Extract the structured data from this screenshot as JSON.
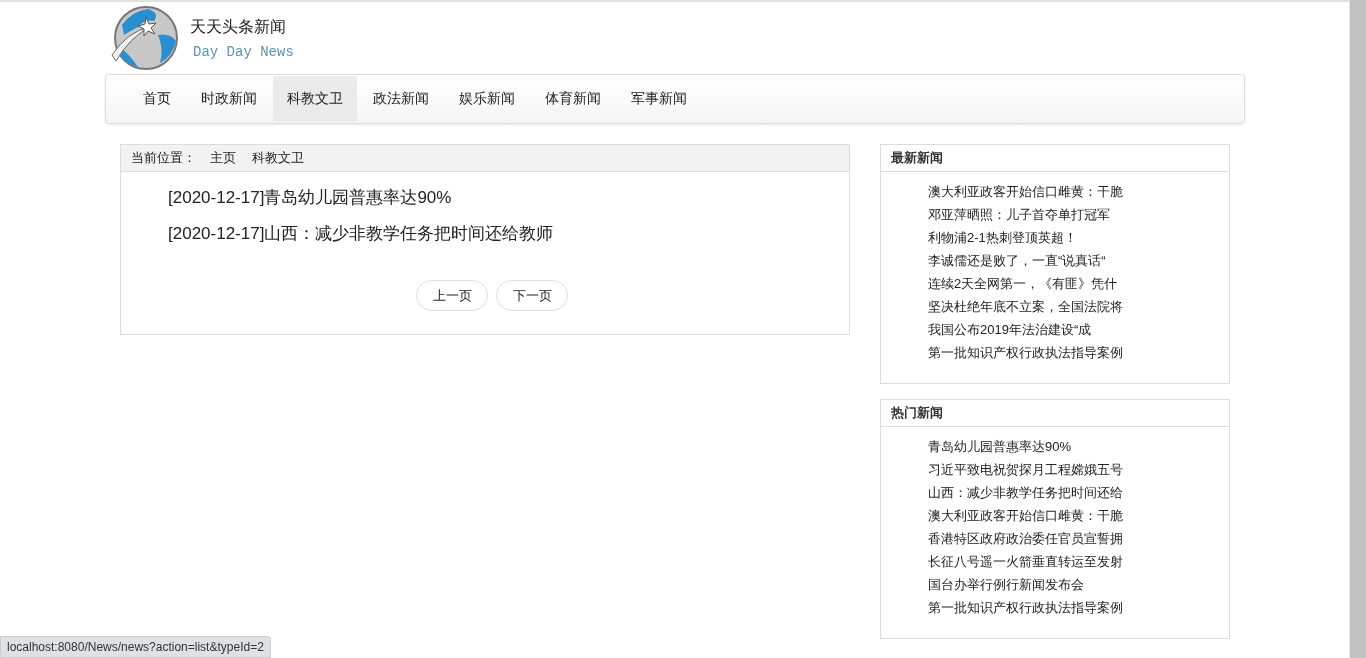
{
  "site": {
    "title": "天天头条新闻",
    "subtitle": "Day Day News"
  },
  "nav": [
    {
      "label": "首页",
      "selected": false
    },
    {
      "label": "时政新闻",
      "selected": false
    },
    {
      "label": "科教文卫",
      "selected": true
    },
    {
      "label": "政法新闻",
      "selected": false
    },
    {
      "label": "娱乐新闻",
      "selected": false
    },
    {
      "label": "体育新闻",
      "selected": false
    },
    {
      "label": "军事新闻",
      "selected": false
    }
  ],
  "breadcrumb": {
    "label": "当前位置：",
    "items": [
      "主页",
      "科教文卫"
    ]
  },
  "articles": [
    {
      "date": "[2020-12-17]",
      "title": "青岛幼儿园普惠率达90%"
    },
    {
      "date": "[2020-12-17]",
      "title": "山西：减少非教学任务把时间还给教师"
    }
  ],
  "pager": [
    "上一页",
    "下一页"
  ],
  "side_panels": [
    {
      "title": "最新新闻",
      "items": [
        "澳大利亚政客开始信口雌黄：干脆",
        "邓亚萍晒照：儿子首夺单打冠军",
        "利物浦2-1热刺登顶英超！",
        "李诚儒还是败了，一直“说真话“",
        "连续2天全网第一，《有匪》凭什",
        "坚决杜绝年底不立案，全国法院将",
        "我国公布2019年法治建设“成",
        "第一批知识产权行政执法指导案例"
      ]
    },
    {
      "title": "热门新闻",
      "items": [
        "青岛幼儿园普惠率达90%",
        "习近平致电祝贺探月工程嫦娥五号",
        "山西：减少非教学任务把时间还给",
        "澳大利亚政客开始信口雌黄：干脆",
        "香港特区政府政治委任官员宣誓拥",
        "长征八号遥一火箭垂直转运至发射",
        "国台办举行例行新闻发布会",
        "第一批知识产权行政执法指导案例"
      ]
    }
  ],
  "status_url": "localhost:8080/News/news?action=list&typeId=2"
}
